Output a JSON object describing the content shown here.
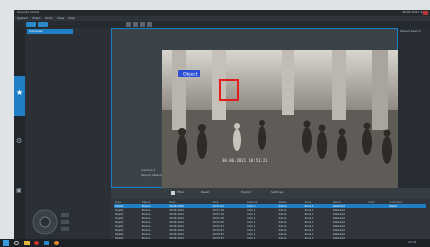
{
  "window": {
    "title": "Security Client",
    "clock": "18.06.2021 12:21"
  },
  "menus": [
    "System",
    "Video",
    "Tools",
    "View",
    "Help"
  ],
  "panel": {
    "header": "Cameras",
    "right_title": "Object search"
  },
  "video": {
    "label": "Object",
    "timestamp": "30.06.2021 10:51:21",
    "info_line1": "Camera 1",
    "info_line2": "Object detected in zone"
  },
  "events_toolbar": {
    "item1": "Filter",
    "item2": "Reset",
    "item3": "Export",
    "item4": "Settings"
  },
  "events": {
    "columns": [
      "Type",
      "Object",
      "Date",
      "Time",
      "Camera",
      "Status",
      "Zone",
      "Result",
      "Note",
      "Comment"
    ],
    "rows": [
      [
        "Object",
        "Person",
        "30.06.2021",
        "10:51:21",
        "Cam 1",
        "Active",
        "Zone 1",
        "Detected",
        "",
        "Match"
      ],
      [
        "Object",
        "Person",
        "30.06.2021",
        "10:51:18",
        "Cam 1",
        "Active",
        "Zone 1",
        "Detected",
        "",
        ""
      ],
      [
        "Object",
        "Person",
        "30.06.2021",
        "10:51:14",
        "Cam 1",
        "Active",
        "Zone 1",
        "Detected",
        "",
        ""
      ],
      [
        "Object",
        "Person",
        "30.06.2021",
        "10:51:10",
        "Cam 1",
        "Active",
        "Zone 2",
        "Detected",
        "",
        ""
      ],
      [
        "Object",
        "Person",
        "30.06.2021",
        "10:51:05",
        "Cam 1",
        "Active",
        "Zone 1",
        "Detected",
        "",
        ""
      ],
      [
        "Object",
        "Person",
        "30.06.2021",
        "10:51:01",
        "Cam 1",
        "Active",
        "Zone 2",
        "Detected",
        "",
        ""
      ],
      [
        "Object",
        "Person",
        "30.06.2021",
        "10:50:57",
        "Cam 1",
        "Active",
        "Zone 1",
        "Detected",
        "",
        ""
      ],
      [
        "Object",
        "Person",
        "30.06.2021",
        "10:50:52",
        "Cam 1",
        "Active",
        "Zone 1",
        "Detected",
        "",
        ""
      ],
      [
        "Object",
        "Person",
        "30.06.2021",
        "10:50:47",
        "Cam 1",
        "Active",
        "Zone 2",
        "Detected",
        "",
        ""
      ]
    ]
  },
  "taskbar": {
    "time": "12:21"
  },
  "colors": {
    "accent": "#1f7fc4",
    "bbox": "#e11d1d",
    "label_bg": "#2a4fd6"
  },
  "icons": [
    "star-icon",
    "gear-icon",
    "camera-icon",
    "windows-icon",
    "search-icon",
    "folder-icon"
  ]
}
